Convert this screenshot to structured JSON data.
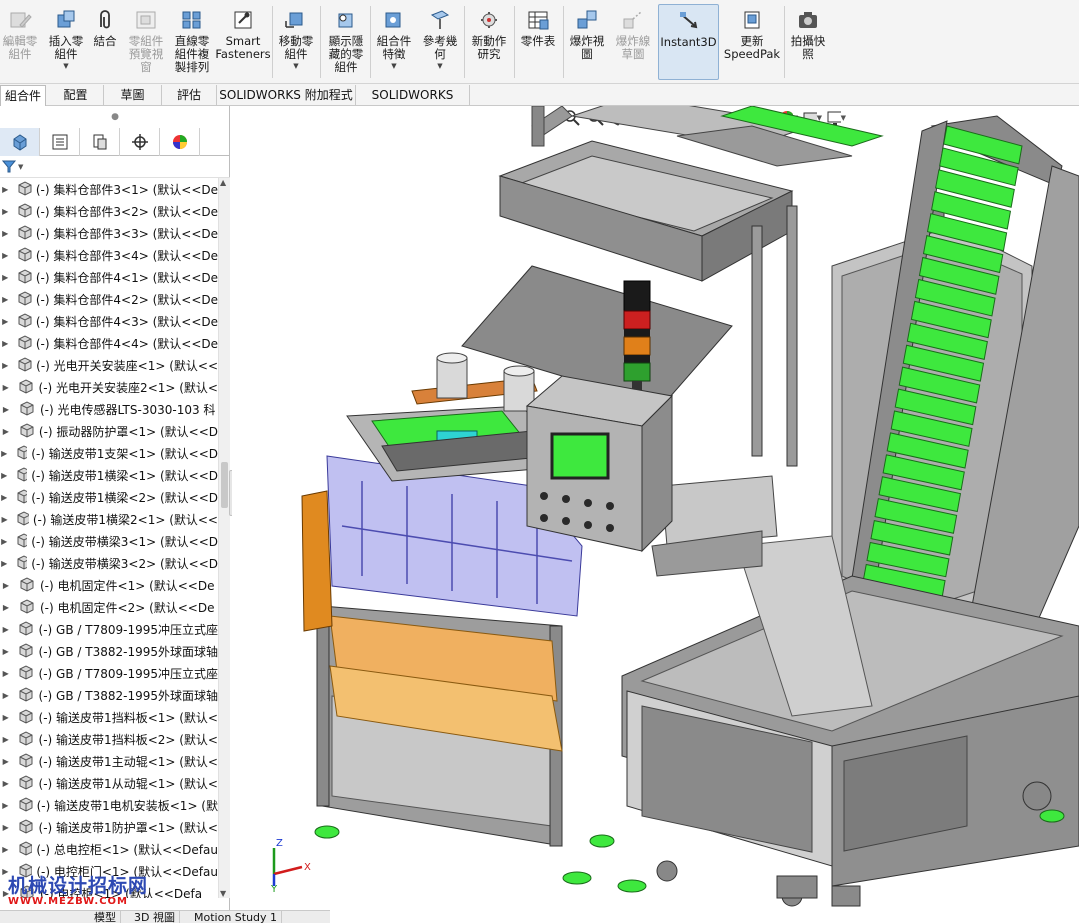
{
  "ribbon": {
    "buttons": [
      {
        "id": "edit-component",
        "label": "編輯零\n組件",
        "disabled": true,
        "has_dropdown": false
      },
      {
        "id": "insert-components",
        "label": "插入零\n組件",
        "disabled": false,
        "has_dropdown": true
      },
      {
        "id": "mate",
        "label": "結合",
        "disabled": false,
        "has_dropdown": false
      },
      {
        "id": "component-preview",
        "label": "零組件\n預覽視\n窗",
        "disabled": true,
        "has_dropdown": false
      },
      {
        "id": "linear-pattern",
        "label": "直線零\n組件複\n製排列",
        "disabled": false,
        "has_dropdown": true
      },
      {
        "id": "smart-fasteners",
        "label": "Smart\nFasteners",
        "disabled": false,
        "has_dropdown": false
      },
      {
        "id": "move-component",
        "label": "移動零\n組件",
        "disabled": false,
        "has_dropdown": true
      },
      {
        "id": "show-hidden",
        "label": "顯示隱\n藏的零\n組件",
        "disabled": false,
        "has_dropdown": false
      },
      {
        "id": "assembly-features",
        "label": "組合件\n特徵",
        "disabled": false,
        "has_dropdown": true
      },
      {
        "id": "reference-geometry",
        "label": "參考幾\n何",
        "disabled": false,
        "has_dropdown": true
      },
      {
        "id": "new-motion-study",
        "label": "新動作\n研究",
        "disabled": false,
        "has_dropdown": false
      },
      {
        "id": "bill-of-materials",
        "label": "零件表",
        "disabled": false,
        "has_dropdown": false
      },
      {
        "id": "exploded-view",
        "label": "爆炸視\n圖",
        "disabled": false,
        "has_dropdown": false
      },
      {
        "id": "explode-line",
        "label": "爆炸線\n草圖",
        "disabled": true,
        "has_dropdown": false
      },
      {
        "id": "instant3d",
        "label": "Instant3D",
        "disabled": false,
        "has_dropdown": false,
        "active": true
      },
      {
        "id": "update-speedpak",
        "label": "更新\nSpeedPak",
        "disabled": false,
        "has_dropdown": false
      },
      {
        "id": "take-snapshot",
        "label": "拍攝快\n照",
        "disabled": false,
        "has_dropdown": false
      }
    ]
  },
  "tabs": [
    {
      "label": "組合件",
      "active": true
    },
    {
      "label": "配置",
      "active": false
    },
    {
      "label": "草圖",
      "active": false
    },
    {
      "label": "評估",
      "active": false
    },
    {
      "label": "SOLIDWORKS 附加程式",
      "active": false
    },
    {
      "label": "SOLIDWORKS MBD",
      "active": false
    }
  ],
  "feature_tree": {
    "items": [
      "(-) 集料仓部件3<1> (默认<<De",
      "(-) 集料仓部件3<2> (默认<<De",
      "(-) 集料仓部件3<3> (默认<<De",
      "(-) 集料仓部件3<4> (默认<<De",
      "(-) 集料仓部件4<1> (默认<<De",
      "(-) 集料仓部件4<2> (默认<<De",
      "(-) 集料仓部件4<3> (默认<<De",
      "(-) 集料仓部件4<4> (默认<<De",
      "(-) 光电开关安装座<1> (默认<<",
      "(-) 光电开关安装座2<1> (默认<",
      "(-) 光电传感器LTS-3030-103 科",
      "(-) 振动器防护罩<1> (默认<<D",
      "(-) 输送皮带1支架<1> (默认<<D",
      "(-) 输送皮带1横梁<1> (默认<<D",
      "(-) 输送皮带1横梁<2> (默认<<D",
      "(-) 输送皮带1横梁2<1> (默认<<",
      "(-) 输送皮带横梁3<1> (默认<<D",
      "(-) 输送皮带横梁3<2> (默认<<D",
      "(-) 电机固定件<1> (默认<<De",
      "(-) 电机固定件<2> (默认<<De",
      "(-) GB / T7809-1995冲压立式座",
      "(-) GB / T3882-1995外球面球轴",
      "(-) GB / T7809-1995冲压立式座",
      "(-) GB / T3882-1995外球面球轴",
      "(-) 输送皮带1挡料板<1> (默认<",
      "(-) 输送皮带1挡料板<2> (默认<",
      "(-) 输送皮带1主动辊<1> (默认<",
      "(-) 输送皮带1从动辊<1> (默认<",
      "(-) 输送皮带1电机安装板<1> (默",
      "(-) 输送皮带1防护罩<1> (默认<",
      "(-) 总电控柜<1> (默认<<Defau",
      "(-) 电控柜门<1> (默认<<Defau",
      "(-) 电控柜<1> (默认<<Defa"
    ]
  },
  "bottom_tabs": [
    "模型",
    "3D 視圖",
    "Motion Study 1"
  ],
  "triad": {
    "x": "X",
    "y": "Y",
    "z": "Z"
  },
  "watermark": {
    "line1": "机械设计招标网",
    "line2": "WWW.MEZBW.COM"
  },
  "colors": {
    "accent": "#2d7fd6",
    "belt_green": "#3ee83e",
    "frame_grey": "#8a8a8a",
    "hopper_purple": "#8c8ce6",
    "guard_orange": "#f0b060"
  }
}
